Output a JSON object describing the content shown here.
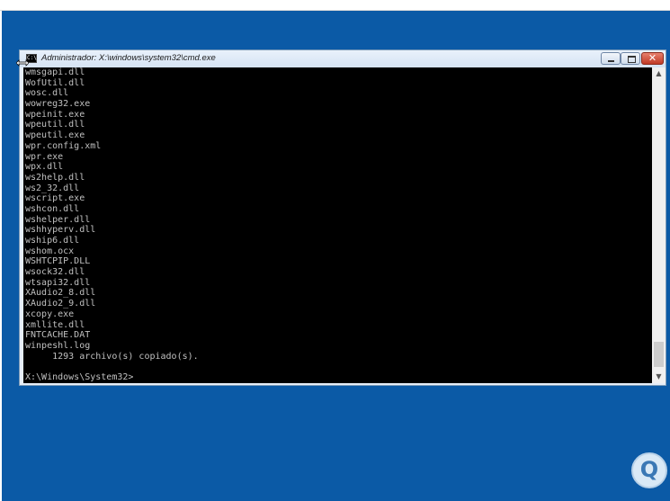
{
  "window": {
    "title": "Administrador: X:\\windows\\system32\\cmd.exe",
    "icon_label": "C:\\",
    "close_label": "✕"
  },
  "console": {
    "lines": [
      "wmsgapi.dll",
      "WofUtil.dll",
      "wosc.dll",
      "wowreg32.exe",
      "wpeinit.exe",
      "wpeutil.dll",
      "wpeutil.exe",
      "wpr.config.xml",
      "wpr.exe",
      "wpx.dll",
      "ws2help.dll",
      "ws2_32.dll",
      "wscript.exe",
      "wshcon.dll",
      "wshelper.dll",
      "wshhyperv.dll",
      "wship6.dll",
      "wshom.ocx",
      "WSHTCPIP.DLL",
      "wsock32.dll",
      "wtsapi32.dll",
      "XAudio2_8.dll",
      "XAudio2_9.dll",
      "xcopy.exe",
      "xmllite.dll",
      "FNTCACHE.DAT",
      "winpeshl.log",
      "     1293 archivo(s) copiado(s).",
      "",
      "X:\\Windows\\System32>"
    ]
  },
  "scrollbar": {
    "up_arrow": "▲",
    "down_arrow": "▼"
  },
  "watermark": {
    "letter": "Q"
  }
}
